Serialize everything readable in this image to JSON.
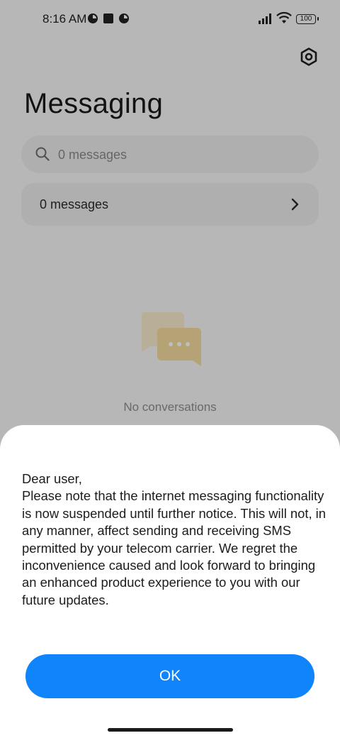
{
  "status_bar": {
    "time": "8:16 AM",
    "battery": "100",
    "icons": [
      "pie-notification-icon",
      "square-notification-icon",
      "pie-notification-icon",
      "signal-icon",
      "wifi-icon",
      "battery-icon"
    ]
  },
  "header": {
    "title": "Messaging",
    "settings_icon": "settings-icon"
  },
  "search": {
    "placeholder": "0 messages"
  },
  "messages_row": {
    "label": "0 messages"
  },
  "empty_state": {
    "text": "No conversations"
  },
  "dialog": {
    "greeting": "Dear user,",
    "body": "Please note that the internet messaging functionality is now suspended until further notice. This will not, in any manner, affect sending and receiving SMS permitted by your telecom carrier. We regret the inconvenience caused and look forward to bringing an enhanced product experience to you with our future updates.",
    "ok_label": "OK"
  },
  "colors": {
    "accent": "#0f84fb",
    "illustration": "#f5dca0"
  }
}
